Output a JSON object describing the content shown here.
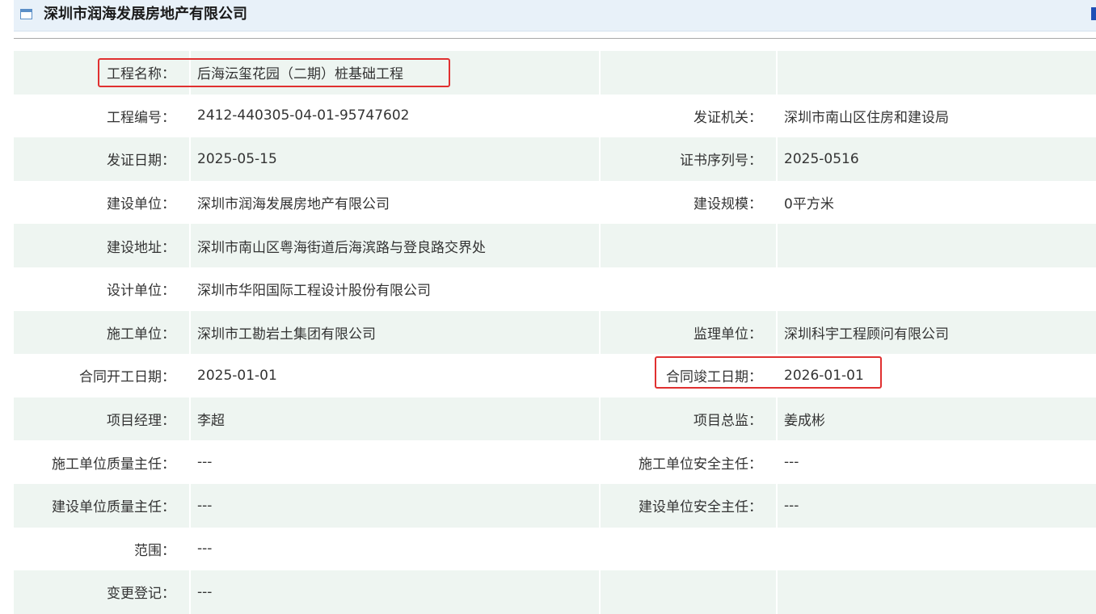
{
  "header": {
    "title": "深圳市润海发展房地产有限公司",
    "icon": "window-icon"
  },
  "colors": {
    "header_bg": "#e8f1f9",
    "row_shade": "#eef5f1",
    "highlight": "#e03030"
  },
  "rows": [
    {
      "label1": "工程名称：",
      "value1": "后海沄玺花园（二期）桩基础工程",
      "label2": "",
      "value2": ""
    },
    {
      "label1": "工程编号：",
      "value1": "2412-440305-04-01-95747602",
      "label2": "发证机关：",
      "value2": "深圳市南山区住房和建设局"
    },
    {
      "label1": "发证日期：",
      "value1": "2025-05-15",
      "label2": "证书序列号：",
      "value2": "2025-0516"
    },
    {
      "label1": "建设单位：",
      "value1": "深圳市润海发展房地产有限公司",
      "label2": "建设规模：",
      "value2": "0平方米"
    },
    {
      "label1": "建设地址：",
      "value1": "深圳市南山区粤海街道后海滨路与登良路交界处",
      "label2": "",
      "value2": ""
    },
    {
      "label1": "设计单位：",
      "value1": "深圳市华阳国际工程设计股份有限公司",
      "label2": "",
      "value2": ""
    },
    {
      "label1": "施工单位：",
      "value1": "深圳市工勘岩土集团有限公司",
      "label2": "监理单位：",
      "value2": "深圳科宇工程顾问有限公司"
    },
    {
      "label1": "合同开工日期：",
      "value1": "2025-01-01",
      "label2": "合同竣工日期：",
      "value2": "2026-01-01"
    },
    {
      "label1": "项目经理：",
      "value1": "李超",
      "label2": "项目总监：",
      "value2": "姜成彬"
    },
    {
      "label1": "施工单位质量主任：",
      "value1": "---",
      "label2": "施工单位安全主任：",
      "value2": "---"
    },
    {
      "label1": "建设单位质量主任：",
      "value1": "---",
      "label2": "建设单位安全主任：",
      "value2": "---"
    },
    {
      "label1": "范围：",
      "value1": "---",
      "label2": "",
      "value2": ""
    },
    {
      "label1": "变更登记：",
      "value1": "---",
      "label2": "",
      "value2": ""
    }
  ]
}
